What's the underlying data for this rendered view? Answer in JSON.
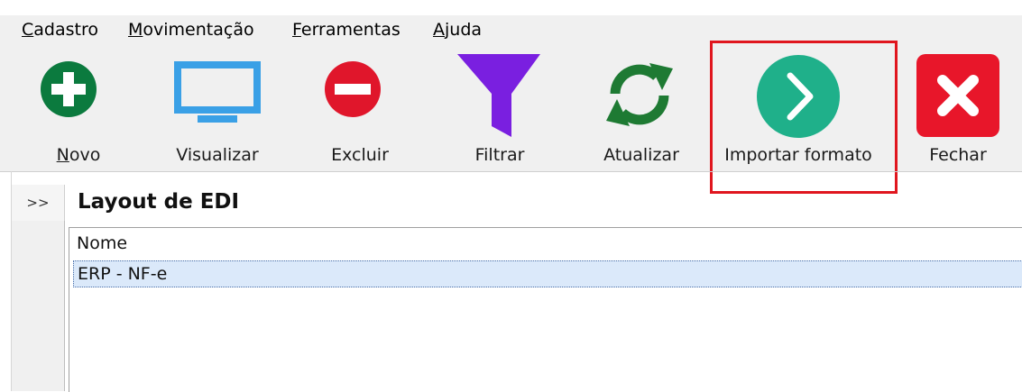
{
  "menu": [
    {
      "mnemonic": "C",
      "rest": "adastro"
    },
    {
      "mnemonic": "M",
      "rest": "ovimentação"
    },
    {
      "mnemonic": "F",
      "rest": "erramentas"
    },
    {
      "mnemonic": "A",
      "rest": "juda"
    }
  ],
  "toolbar": {
    "novo": {
      "mnemonic": "N",
      "rest": "ovo",
      "icon": "plus-circle-icon",
      "color": "#0b7a3e"
    },
    "visualizar": {
      "label": "Visualizar",
      "icon": "monitor-icon",
      "color": "#3aa0e6"
    },
    "excluir": {
      "label": "Excluir",
      "icon": "minus-circle-icon",
      "color": "#e0162b"
    },
    "filtrar": {
      "label": "Filtrar",
      "icon": "funnel-icon",
      "color": "#7a1fe0"
    },
    "atualizar": {
      "label": "Atualizar",
      "icon": "refresh-icon",
      "color": "#1e7a33"
    },
    "importar": {
      "label": "Importar formato",
      "icon": "chevron-right-circle-icon",
      "color": "#1fb08a"
    },
    "fechar": {
      "label": "Fechar",
      "icon": "close-square-icon",
      "color": "#e8162a"
    }
  },
  "side_toggle": ">>",
  "panel": {
    "title": "Layout de EDI",
    "column_header": "Nome",
    "rows": [
      "ERP - NF-e"
    ]
  }
}
